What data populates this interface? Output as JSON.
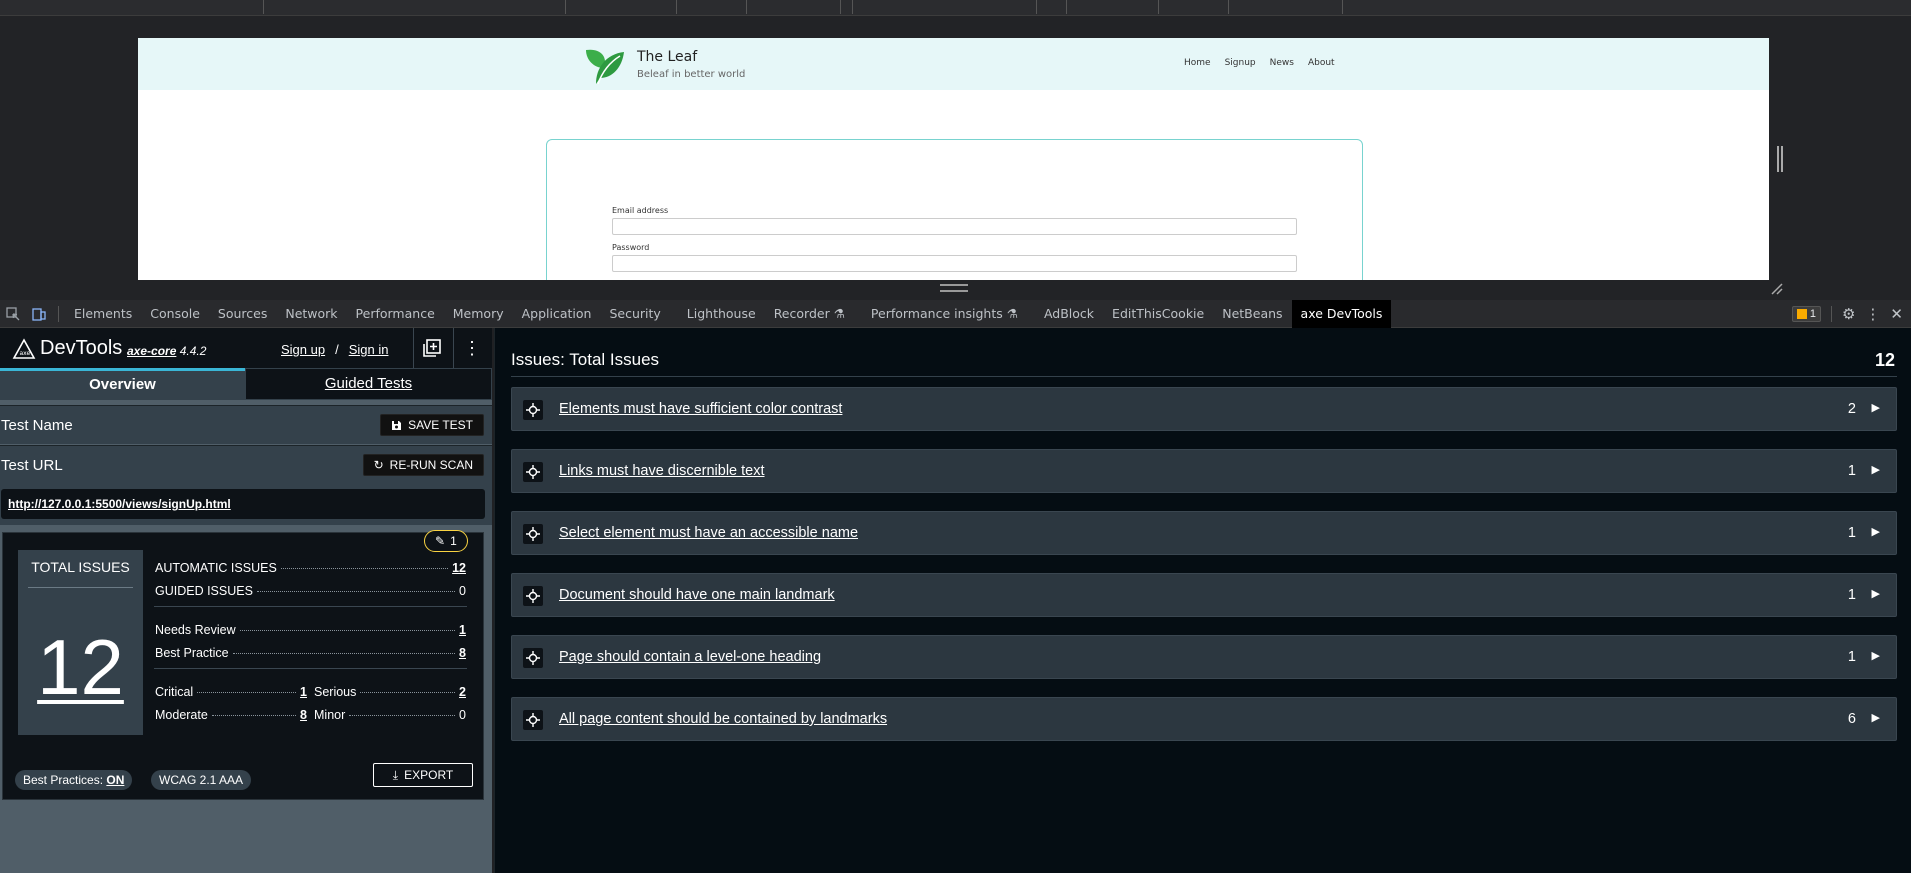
{
  "browser_page": {
    "site_title": "The Leaf",
    "site_tagline": "Beleaf in better world",
    "nav": [
      "Home",
      "Signup",
      "News",
      "About"
    ],
    "email_label": "Email address",
    "password_label": "Password"
  },
  "devtools_tabs": [
    "Elements",
    "Console",
    "Sources",
    "Network",
    "Performance",
    "Memory",
    "Application",
    "Security",
    "Lighthouse",
    "Recorder",
    "Performance insights",
    "AdBlock",
    "EditThisCookie",
    "NetBeans",
    "axe DevTools"
  ],
  "devtools_active_tab": "axe DevTools",
  "devtools_issue_badge": "1",
  "axe": {
    "title": "DevTools",
    "core_label": "axe-core",
    "core_version": "4.4.2",
    "sign_up": "Sign up",
    "slash": "/",
    "sign_in": "Sign in",
    "tabs": {
      "overview": "Overview",
      "guided": "Guided Tests"
    },
    "test_name_label": "Test Name",
    "save_test": "SAVE TEST",
    "test_url_label": "Test URL",
    "rerun_scan": "RE-RUN SCAN",
    "test_url": "http://127.0.0.1:5500/views/signUp.html",
    "pencil_count": "1",
    "total_issues_label": "TOTAL ISSUES",
    "total_issues": "12",
    "automatic_label": "AUTOMATIC ISSUES",
    "automatic": "12",
    "guided_label": "GUIDED ISSUES",
    "guided": "0",
    "needs_review_label": "Needs Review",
    "needs_review": "1",
    "best_practice_label": "Best Practice",
    "best_practice": "8",
    "critical_label": "Critical",
    "critical": "1",
    "serious_label": "Serious",
    "serious": "2",
    "moderate_label": "Moderate",
    "moderate": "8",
    "minor_label": "Minor",
    "minor": "0",
    "best_practices_label": "Best Practices: ",
    "best_practices_value": "ON",
    "wcag": "WCAG 2.1 AAA",
    "export": "EXPORT"
  },
  "issues": {
    "title": "Issues: Total Issues",
    "total": "12",
    "items": [
      {
        "title": "Elements must have sufficient color contrast",
        "count": "2"
      },
      {
        "title": "Links must have discernible text",
        "count": "1"
      },
      {
        "title": "Select element must have an accessible name",
        "count": "1"
      },
      {
        "title": "Document should have one main landmark",
        "count": "1"
      },
      {
        "title": "Page should contain a level-one heading",
        "count": "1"
      },
      {
        "title": "All page content should be contained by landmarks",
        "count": "6"
      }
    ]
  }
}
